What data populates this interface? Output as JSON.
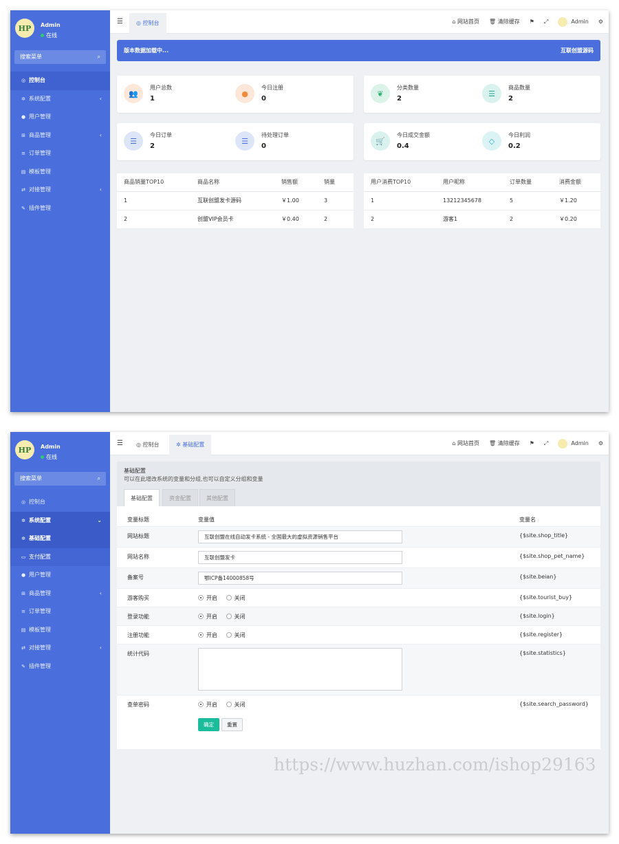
{
  "sidebar": {
    "avatar_text": "HP",
    "username": "Admin",
    "status": "在线",
    "search_placeholder": "搜索菜单"
  },
  "topbar": {
    "tab_dashboard": "控制台",
    "tab_basic": "基础配置",
    "home": "网站首页",
    "clear_cache": "清除缓存",
    "user": "Admin"
  },
  "screen1": {
    "menu": [
      {
        "label": "控制台",
        "icon": "dashboard-icon",
        "glyph": "◎"
      },
      {
        "label": "系统配置",
        "icon": "gear-icon",
        "glyph": "✲"
      },
      {
        "label": "用户管理",
        "icon": "user-icon",
        "glyph": "●"
      },
      {
        "label": "商品管理",
        "icon": "cart-icon",
        "glyph": "⊞"
      },
      {
        "label": "订单管理",
        "icon": "list-icon",
        "glyph": "≡"
      },
      {
        "label": "模板管理",
        "icon": "template-icon",
        "glyph": "▤"
      },
      {
        "label": "对接管理",
        "icon": "exchange-icon",
        "glyph": "⇄"
      },
      {
        "label": "插件管理",
        "icon": "plugin-icon",
        "glyph": "✎"
      }
    ],
    "notice": "版本数据加载中...",
    "notice_link": "互联创盟源码",
    "stats": [
      {
        "label": "用户总数",
        "value": "1",
        "icon": "users-icon",
        "glyph": "👥"
      },
      {
        "label": "今日注册",
        "value": "0",
        "icon": "user-add-icon",
        "glyph": "●"
      },
      {
        "label": "分类数量",
        "value": "2",
        "icon": "leaf-icon",
        "glyph": "❦"
      },
      {
        "label": "商品数量",
        "value": "2",
        "icon": "list-icon",
        "glyph": "☰"
      },
      {
        "label": "今日订单",
        "value": "2",
        "icon": "order-icon",
        "glyph": "☰"
      },
      {
        "label": "待处理订单",
        "value": "0",
        "icon": "pending-icon",
        "glyph": "☰"
      },
      {
        "label": "今日成交金额",
        "value": "0.4",
        "icon": "cart-icon",
        "glyph": "🛒"
      },
      {
        "label": "今日利润",
        "value": "0.2",
        "icon": "diamond-icon",
        "glyph": "◇"
      }
    ],
    "goods_table": {
      "headers": [
        "商品销量TOP10",
        "商品名称",
        "销售额",
        "销量"
      ],
      "rows": [
        [
          "1",
          "互联创盟发卡源码",
          "￥1.00",
          "3"
        ],
        [
          "2",
          "创盟VIP会员卡",
          "￥0.40",
          "2"
        ]
      ]
    },
    "user_table": {
      "headers": [
        "用户消费TOP10",
        "用户昵称",
        "订单数量",
        "消费金额"
      ],
      "rows": [
        [
          "1",
          "13212345678",
          "5",
          "￥1.20"
        ],
        [
          "2",
          "游客1",
          "2",
          "￥0.20"
        ]
      ]
    }
  },
  "screen2": {
    "menu": [
      {
        "label": "控制台",
        "icon": "dashboard-icon",
        "glyph": "◎"
      },
      {
        "label": "系统配置",
        "icon": "gear-icon",
        "glyph": "✲"
      },
      {
        "label": "基础配置",
        "icon": "gear-icon",
        "glyph": "✲"
      },
      {
        "label": "支付配置",
        "icon": "card-icon",
        "glyph": "▭"
      },
      {
        "label": "用户管理",
        "icon": "user-icon",
        "glyph": "●"
      },
      {
        "label": "商品管理",
        "icon": "cart-icon",
        "glyph": "⊞"
      },
      {
        "label": "订单管理",
        "icon": "list-icon",
        "glyph": "≡"
      },
      {
        "label": "模板管理",
        "icon": "template-icon",
        "glyph": "▤"
      },
      {
        "label": "对接管理",
        "icon": "exchange-icon",
        "glyph": "⇄"
      },
      {
        "label": "插件管理",
        "icon": "plugin-icon",
        "glyph": "✎"
      }
    ],
    "panel_title": "基础配置",
    "panel_desc": "可以在此增改系统的变量和分组,也可以自定义分组和变量",
    "tabs": [
      "基础配置",
      "资金配置",
      "其他配置"
    ],
    "col_title": "变量标题",
    "col_value": "变量值",
    "col_name": "变量名",
    "fields": {
      "shop_title": {
        "label": "网站标题",
        "value": "互联创盟在线自动发卡系统 - 全国最大的虚拟资源销售平台",
        "var": "{$site.shop_title}"
      },
      "shop_pet_name": {
        "label": "网站名称",
        "value": "互联创盟发卡",
        "var": "{$site.shop_pet_name}"
      },
      "beian": {
        "label": "备案号",
        "value": "鄂ICP备14000858号",
        "var": "{$site.beian}"
      },
      "tourist_buy": {
        "label": "游客购买",
        "var": "{$site.tourist_buy}"
      },
      "login": {
        "label": "登录功能",
        "var": "{$site.login}"
      },
      "register": {
        "label": "注册功能",
        "var": "{$site.register}"
      },
      "statistics": {
        "label": "统计代码",
        "var": "{$site.statistics}"
      },
      "search_password": {
        "label": "查单密码",
        "var": "{$site.search_password}"
      }
    },
    "radio_on": "开启",
    "radio_off": "关闭",
    "btn_ok": "确定",
    "btn_reset": "重置"
  },
  "watermark": "https://www.huzhan.com/ishop29163"
}
